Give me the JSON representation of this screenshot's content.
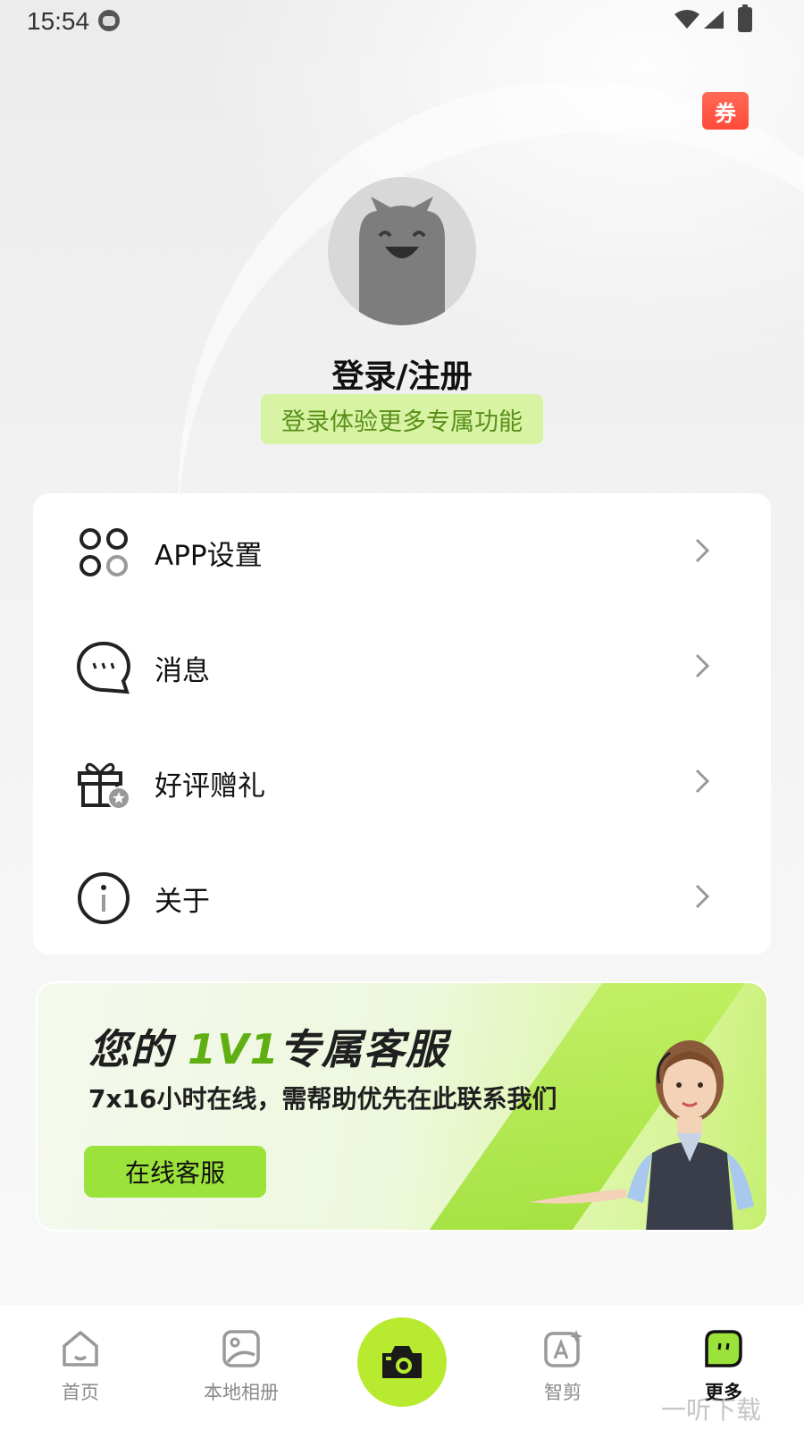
{
  "status_bar": {
    "time": "15:54"
  },
  "header": {
    "coupon_label": "券"
  },
  "profile": {
    "login_title": "登录/注册",
    "login_subtitle": "登录体验更多专属功能"
  },
  "menu": {
    "items": [
      {
        "label": "APP设置",
        "icon": "settings-grid-icon"
      },
      {
        "label": "消息",
        "icon": "message-bubble-icon"
      },
      {
        "label": "好评赠礼",
        "icon": "gift-icon"
      },
      {
        "label": "关于",
        "icon": "info-icon"
      }
    ]
  },
  "promo": {
    "title_pre": "您的 ",
    "title_highlight": "1V1",
    "title_post": "专属客服",
    "subtitle": "7x16小时在线，需帮助优先在此联系我们",
    "button_label": "在线客服"
  },
  "tab_bar": {
    "tabs": [
      {
        "label": "首页",
        "icon": "home-icon"
      },
      {
        "label": "本地相册",
        "icon": "album-icon"
      },
      {
        "label": "智剪",
        "icon": "ai-edit-icon"
      },
      {
        "label": "更多",
        "icon": "more-icon",
        "active": true
      }
    ],
    "center_icon": "camera-icon"
  },
  "watermark": "一听下载",
  "colors": {
    "accent_green": "#b8ea2f",
    "promo_highlight": "#5fae12",
    "subtitle_bg": "#d7f3a3",
    "coupon_red": "#ff4a3a"
  }
}
